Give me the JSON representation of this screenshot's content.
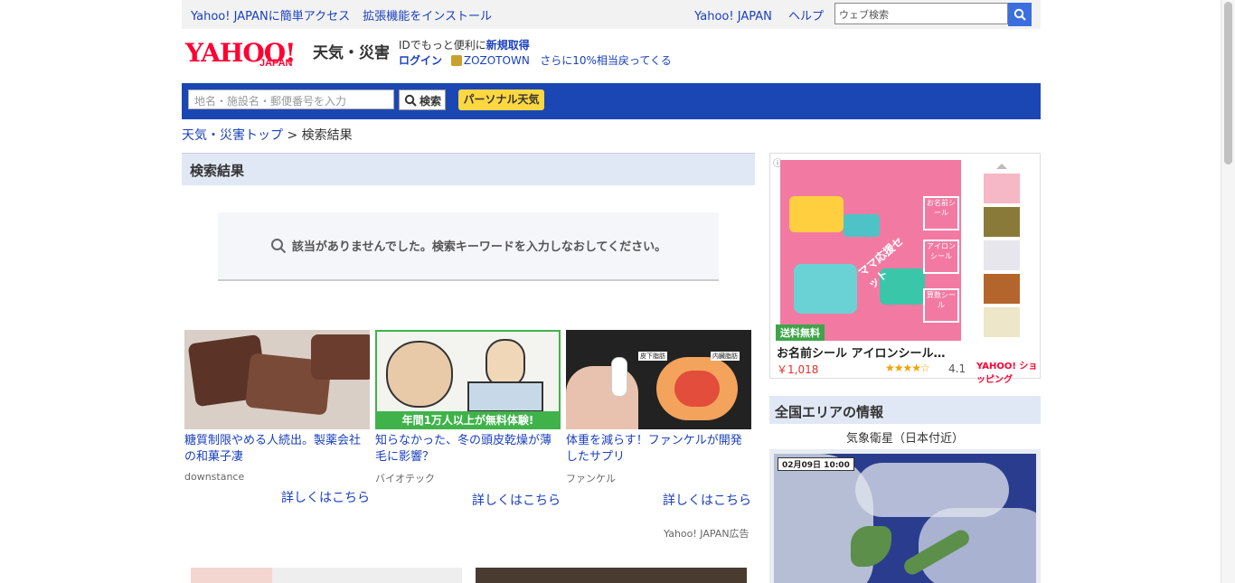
{
  "topbar": {
    "links_left": [
      "Yahoo! JAPANに簡単アクセス",
      "拡張機能をインストール"
    ],
    "links_right": [
      "Yahoo! JAPAN",
      "ヘルプ"
    ],
    "search_placeholder": "ウェブ検索"
  },
  "brand": {
    "logo_text": "YAHOO!",
    "logo_sub": "JAPAN",
    "section": "天気・災害"
  },
  "promo": {
    "line1_prefix": "IDでもっと便利に",
    "line1_link": "新規取得",
    "login": "ログイン",
    "zozo": "ZOZOTOWN",
    "zozo_text": "さらに10%相当戻ってくる"
  },
  "search": {
    "placeholder": "地名・施設名・郵便番号を入力",
    "button": "検索",
    "personal": "パーソナル天気"
  },
  "breadcrumb": {
    "home": "天気・災害トップ",
    "sep": ">",
    "current": "検索結果"
  },
  "results": {
    "heading": "検索結果",
    "empty_message": "該当がありませんでした。検索キーワードを入力しなおしてください。"
  },
  "ads": [
    {
      "title": "糖質制限やめる人続出。製薬会社の和菓子凄",
      "source": "downstance",
      "more": "詳しくはこちら"
    },
    {
      "title": "知らなかった、冬の頭皮乾燥が薄毛に影響？",
      "source": "バイオテック",
      "more": "詳しくはこちら",
      "image_caption": "年間1万人以上が無料体験!"
    },
    {
      "title": "体重を減らす！ファンケルが開発したサプリ",
      "source": "ファンケル",
      "more": "詳しくはこちら",
      "image_labels": [
        "皮下脂肪",
        "内臓脂肪"
      ]
    }
  ],
  "ad_credit": "Yahoo! JAPAN広告",
  "shopping": {
    "badge": "送料無料",
    "name": "お名前シール アイロンシール…",
    "price": "￥1,018",
    "stars": "★★★★☆",
    "rating": "4.1",
    "shop_logo": "YAHOO! ショッピング",
    "image_text": [
      "ママ応援セット",
      "お名前シール",
      "アイロンシール",
      "算数シール"
    ]
  },
  "area": {
    "heading": "全国エリアの情報",
    "satellite_title": "気象衛星（日本付近）",
    "timestamp": "02月09日 10:00"
  },
  "colors": {
    "link": "#1a40bf",
    "band": "#1b47b5",
    "personal_btn": "#ffd740",
    "logo_red": "#ff0033"
  }
}
